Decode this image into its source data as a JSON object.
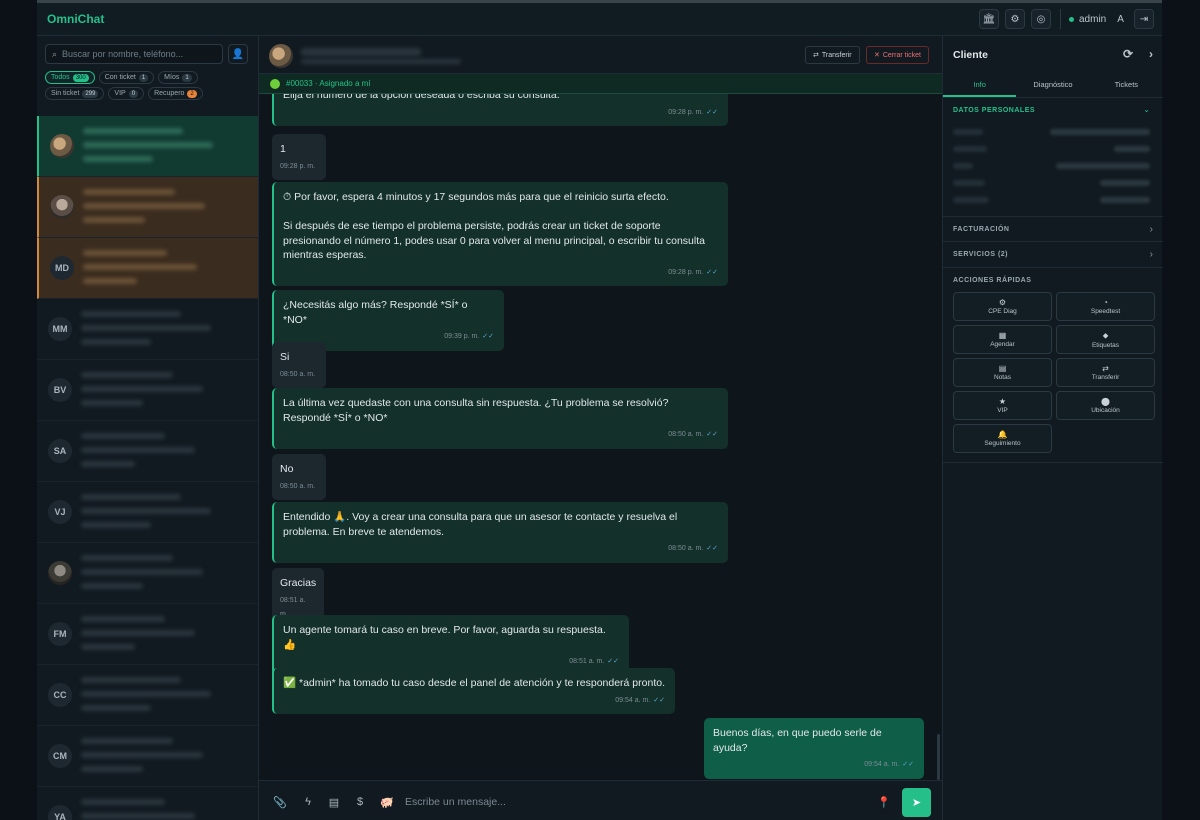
{
  "app": {
    "brand": "OmniChat",
    "user_name": "admin",
    "user_initial": "A"
  },
  "icons": {
    "topbar": [
      "bank-icon",
      "gear-icon",
      "headset-icon",
      "logout-icon"
    ]
  },
  "sidebar": {
    "search_placeholder": "Buscar por nombre, teléfono...",
    "filters": [
      {
        "label": "Todos",
        "count": "300",
        "active": true
      },
      {
        "label": "Con ticket",
        "count": "1"
      },
      {
        "label": "Míos",
        "count": "1"
      },
      {
        "label": "Sin ticket",
        "count": "299"
      },
      {
        "label": "VIP",
        "count": "0"
      },
      {
        "label": "Recupero",
        "count": "2"
      }
    ],
    "conversations": [
      {
        "initials": ""
      },
      {
        "initials": ""
      },
      {
        "initials": "MD"
      },
      {
        "initials": "MM"
      },
      {
        "initials": "BV"
      },
      {
        "initials": "SA"
      },
      {
        "initials": "VJ"
      },
      {
        "initials": ""
      },
      {
        "initials": "FM"
      },
      {
        "initials": "CC"
      },
      {
        "initials": "CM"
      },
      {
        "initials": "YA"
      }
    ]
  },
  "chat": {
    "transfer_label": "Transferir",
    "close_ticket_label": "Cerrar ticket",
    "ticket_info": "#00033 · Asignado a mí",
    "messages": [
      {
        "text": "Elija el número de la opción deseada o escriba su consulta.",
        "time": "09:28 p. m."
      },
      {
        "text": "1",
        "time": "09:28 p. m."
      },
      {
        "text": "⏱ Por favor, espera 4 minutos y 17 segundos más para que el reinicio surta efecto.\n\nSi después de ese tiempo el problema persiste, podrás crear un ticket de soporte presionando el número 1, podes usar 0 para volver al menu principal, o escribir tu consulta mientras esperas.",
        "time": "09:28 p. m."
      },
      {
        "text": "¿Necesitás algo más? Respondé *SÍ* o *NO*",
        "time": "09:39 p. m."
      },
      {
        "text": "Si",
        "time": "08:50 a. m."
      },
      {
        "text": "La última vez quedaste con una consulta sin respuesta. ¿Tu problema se resolvió? Respondé *SÍ* o *NO*",
        "time": "08:50 a. m."
      },
      {
        "text": "No",
        "time": "08:50 a. m."
      },
      {
        "text": "Entendido 🙏. Voy a crear una consulta para que un asesor te contacte y resuelva el problema. En breve te atendemos.",
        "time": "08:50 a. m."
      },
      {
        "text": "Gracias",
        "time": "08:51 a. m."
      },
      {
        "text": "Un agente tomará tu caso en breve. Por favor, aguarda su respuesta. 👍",
        "time": "08:51 a. m."
      },
      {
        "text": "✅ *admin* ha tomado tu caso desde el panel de atención y te responderá pronto.",
        "time": "09:54 a. m."
      },
      {
        "text": "Buenos días, en que puedo serle de ayuda?",
        "time": "09:54 a. m."
      }
    ],
    "composer_placeholder": "Escribe un mensaje..."
  },
  "client_panel": {
    "title": "Cliente",
    "tabs": [
      "Info",
      "Diagnóstico",
      "Tickets"
    ],
    "active_tab": "Info",
    "sections": {
      "personal": "DATOS PERSONALES",
      "billing": "FACTURACIÓN",
      "services": "SERVICIOS (2)",
      "quick_actions": "ACCIONES RÁPIDAS"
    },
    "quick_actions": [
      {
        "label": "CPE Diag",
        "icon": "gear-icon"
      },
      {
        "label": "Speedtest",
        "icon": "speedometer-icon"
      },
      {
        "label": "Agendar",
        "icon": "calendar-icon"
      },
      {
        "label": "Etiquetas",
        "icon": "tag-icon"
      },
      {
        "label": "Notas",
        "icon": "note-icon"
      },
      {
        "label": "Transferir",
        "icon": "transfer-icon"
      },
      {
        "label": "VIP",
        "icon": "star-icon"
      },
      {
        "label": "Ubicación",
        "icon": "location-icon"
      },
      {
        "label": "Seguimiento",
        "icon": "bell-icon"
      }
    ]
  },
  "colors": {
    "accent": "#25c08a",
    "danger": "#f07070",
    "warning": "#e6823a"
  }
}
